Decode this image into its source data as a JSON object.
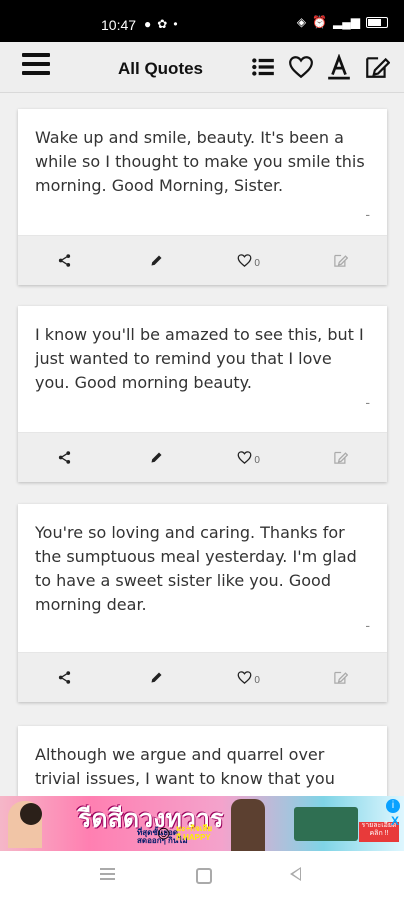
{
  "status_bar": {
    "time": "10:47",
    "left_icons": [
      "chat-icon",
      "settings-icon",
      "dot-icon"
    ],
    "right_icons": [
      "wifi-icon",
      "alarm-icon",
      "signal-icon",
      "battery-icon"
    ]
  },
  "app_bar": {
    "title": "All Quotes",
    "icons": [
      "menu-icon",
      "list-icon",
      "heart-icon",
      "text-format-icon",
      "edit-note-icon"
    ]
  },
  "quotes": [
    {
      "text": "Wake up and smile, beauty. It's been a while so I thought to make you smile this morning. Good Morning, Sister.",
      "author": "-",
      "likes": "0"
    },
    {
      "text": "I know you'll be amazed to see this, but I just wanted to remind you that I love you. Good morning beauty.",
      "author": "-",
      "likes": "0"
    },
    {
      "text": "You're so loving and caring. Thanks for the sumptuous meal yesterday. I'm glad to have a sweet sister like you. Good morning dear.",
      "author": "-",
      "likes": "0"
    },
    {
      "text": "Although we argue and quarrel over trivial issues, I want to know that you mean the",
      "author": "",
      "likes": ""
    }
  ],
  "card_actions": {
    "share_icon": "share-icon",
    "edit_icon": "pencil-icon",
    "like_icon": "heart-icon",
    "copy_icon": "edit-note-icon"
  },
  "ad": {
    "headline": "รีดสีดวงทวาร",
    "lines": "ที่สุดชั้นยอด\nสดออกๆ กินไม่",
    "happy": "มะ+กิจเสีย\nกี HAPPY",
    "badge": "รายละเอียด\nคลิก !!",
    "info": "i",
    "close": "X"
  },
  "nav_bar": {
    "icons": [
      "recents-icon",
      "home-icon",
      "back-icon"
    ]
  },
  "colors": {
    "status_bar": "#000000",
    "app_bar": "#eeeeee",
    "card": "#ffffff",
    "action_bar": "#eeeeee"
  }
}
